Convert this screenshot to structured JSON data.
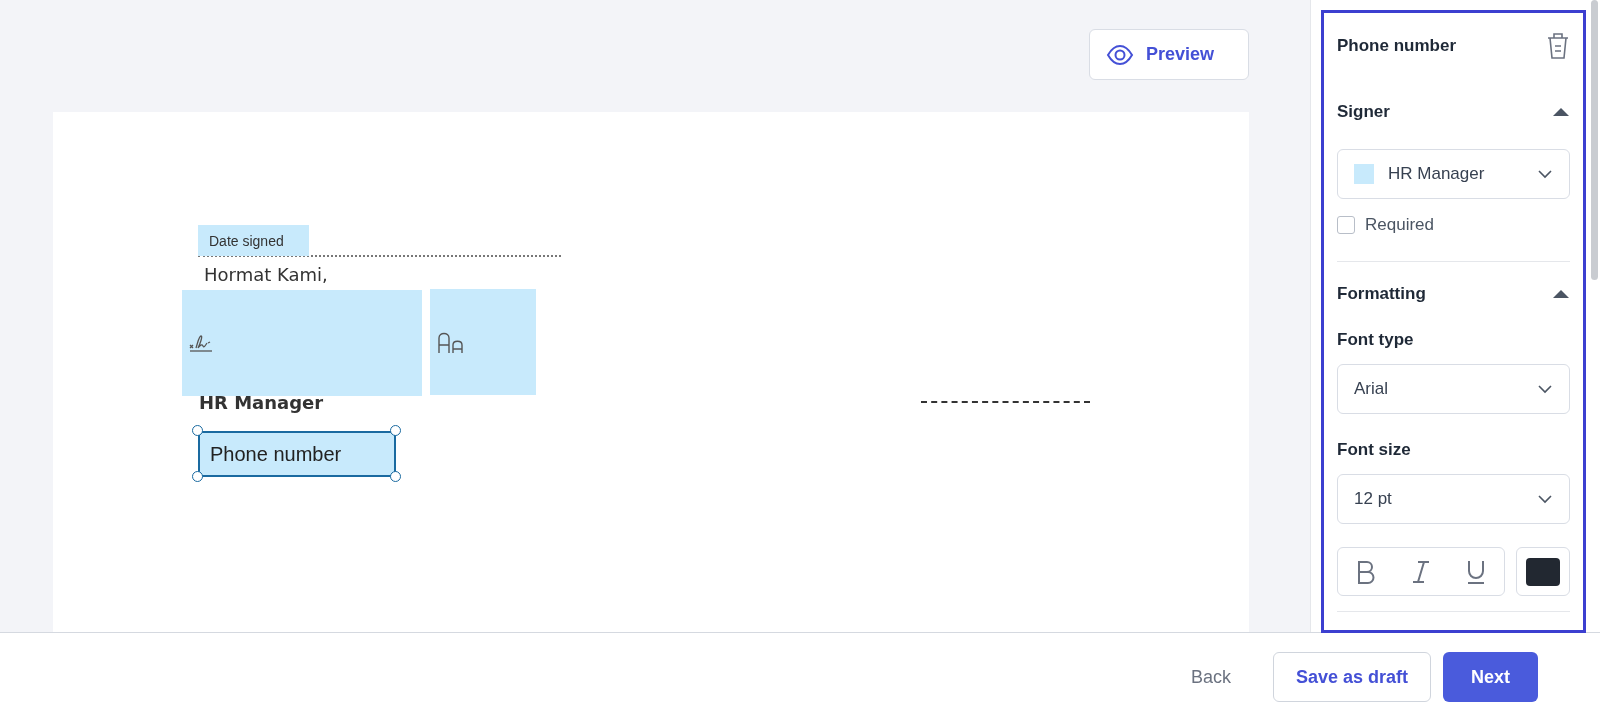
{
  "toolbar": {
    "preview_button": "Preview"
  },
  "document": {
    "lines": [
      {
        "kind": "dots"
      },
      {
        "kind": "text",
        "text": "Hormat Kami,"
      },
      {
        "kind": "bold",
        "text": "HR Manager"
      },
      {
        "kind": "rule"
      }
    ],
    "fields": [
      {
        "kind": "label",
        "text": "Date signed",
        "selected": false
      },
      {
        "kind": "signature",
        "selected": false
      },
      {
        "kind": "initials",
        "selected": false
      },
      {
        "kind": "text",
        "text": "Phone number",
        "selected": true
      }
    ]
  },
  "panel": {
    "title": "Phone number",
    "signer": {
      "title": "Signer",
      "expanded": true,
      "value": "HR Manager",
      "color": "#c8eafc",
      "required_label": "Required",
      "required": false
    },
    "formatting": {
      "title": "Formatting",
      "expanded": true,
      "font_type": {
        "label": "Font type",
        "value": "Arial"
      },
      "font_size": {
        "label": "Font size",
        "value": "12 pt"
      },
      "bold": false,
      "italic": false,
      "underline": false,
      "color": "#222831"
    }
  },
  "footer": {
    "buttons": [
      {
        "kind": "link",
        "label": "Back"
      },
      {
        "kind": "outline",
        "label": "Save as draft"
      },
      {
        "kind": "primary",
        "label": "Next"
      }
    ]
  }
}
